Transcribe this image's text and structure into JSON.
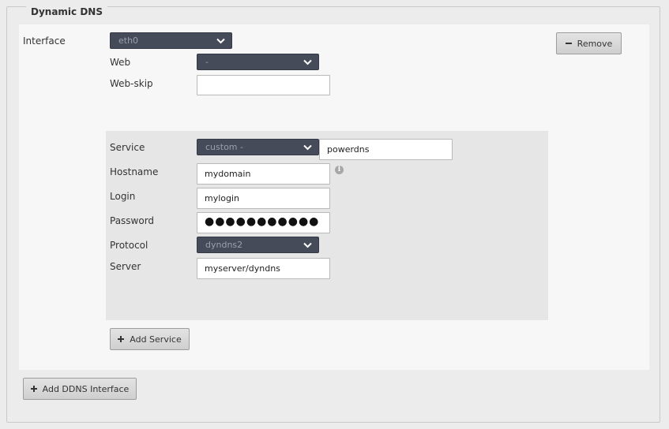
{
  "section": {
    "title": "Dynamic DNS"
  },
  "interface": {
    "label": "Interface",
    "value": "eth0",
    "remove_label": "Remove"
  },
  "web": {
    "label": "Web",
    "value": "-"
  },
  "web_skip": {
    "label": "Web-skip",
    "value": ""
  },
  "service": {
    "label": "Service",
    "select_value": "custom -",
    "custom_value": "powerdns",
    "hostname": {
      "label": "Hostname",
      "value": "mydomain"
    },
    "login": {
      "label": "Login",
      "value": "mylogin"
    },
    "password": {
      "label": "Password",
      "value": "●●●●●●●●●●●"
    },
    "protocol": {
      "label": "Protocol",
      "value": "dyndns2"
    },
    "server": {
      "label": "Server",
      "value": "myserver/dyndns"
    }
  },
  "buttons": {
    "add_service": "Add Service",
    "add_ddns_interface": "Add DDNS Interface"
  },
  "icons": {
    "info": "i",
    "plus": "plus-icon",
    "minus": "minus-icon",
    "chevron": "chevron-down-icon"
  },
  "colors": {
    "select_bg": "#464b5a",
    "panel_bg": "#f7f7f7",
    "service_bg": "#e6e6e6"
  }
}
